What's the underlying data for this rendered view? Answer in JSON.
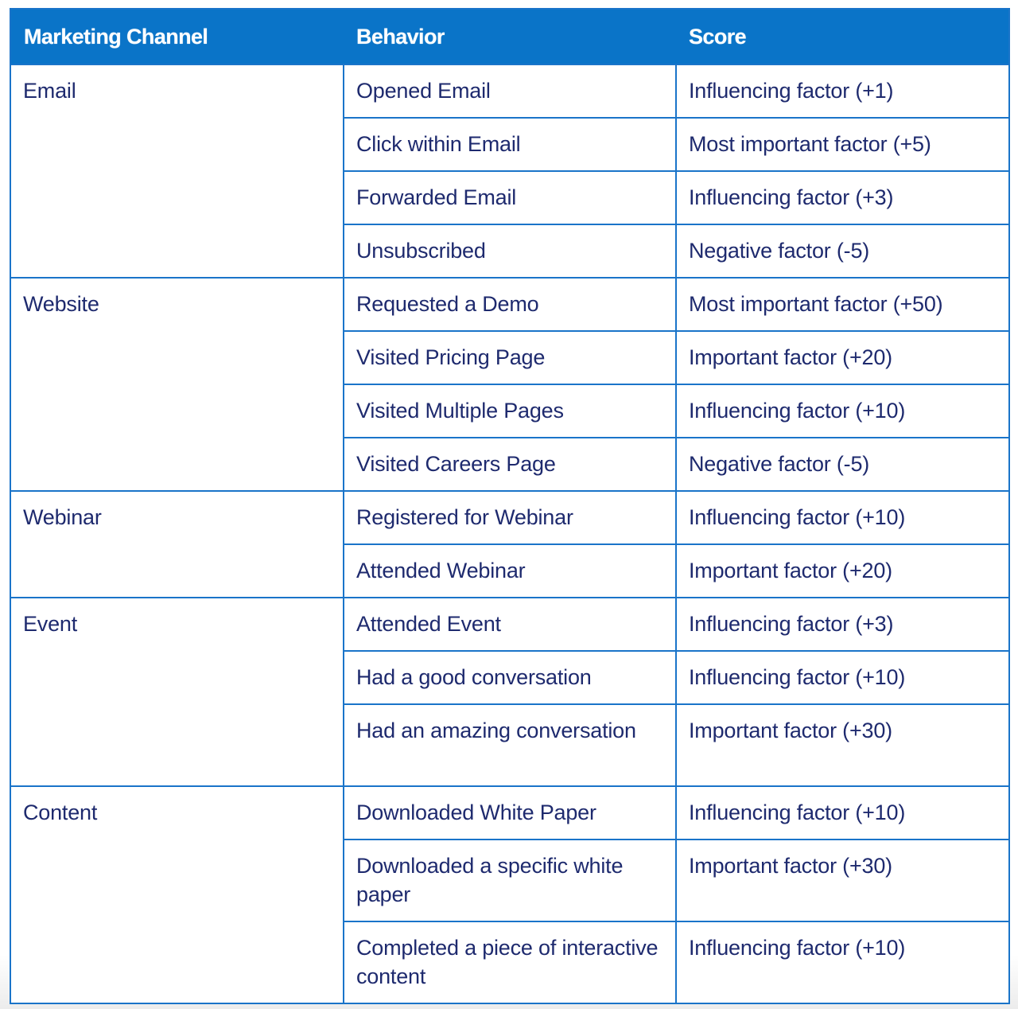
{
  "table": {
    "headers": [
      "Marketing Channel",
      "Behavior",
      "Score"
    ],
    "colors": {
      "header_bg": "#0a74c8",
      "header_text": "#ffffff",
      "border": "#1a74c9",
      "cell_text": "#1e2a6e"
    },
    "groups": [
      {
        "channel": "Email",
        "rows": [
          {
            "behavior": "Opened Email",
            "score": "Influencing factor (+1)"
          },
          {
            "behavior": "Click within Email",
            "score": "Most important factor (+5)"
          },
          {
            "behavior": "Forwarded Email",
            "score": "Influencing factor (+3)"
          },
          {
            "behavior": "Unsubscribed",
            "score": "Negative factor (-5)"
          }
        ]
      },
      {
        "channel": "Website",
        "rows": [
          {
            "behavior": "Requested a Demo",
            "score": "Most important factor (+50)"
          },
          {
            "behavior": "Visited Pricing Page",
            "score": "Important factor (+20)"
          },
          {
            "behavior": "Visited Multiple Pages",
            "score": "Influencing factor (+10)"
          },
          {
            "behavior": "Visited Careers Page",
            "score": "Negative factor (-5)"
          }
        ]
      },
      {
        "channel": "Webinar",
        "rows": [
          {
            "behavior": "Registered for Webinar",
            "score": "Influencing factor (+10)"
          },
          {
            "behavior": "Attended Webinar",
            "score": "Important factor (+20)"
          }
        ]
      },
      {
        "channel": "Event",
        "rows": [
          {
            "behavior": "Attended Event",
            "score": "Influencing factor (+3)"
          },
          {
            "behavior": "Had a good conversation",
            "score": "Influencing factor (+10)"
          },
          {
            "behavior": "Had an amazing conversation",
            "score": "Important factor (+30)"
          }
        ]
      },
      {
        "channel": "Content",
        "rows": [
          {
            "behavior": "Downloaded White Paper",
            "score": "Influencing factor (+10)"
          },
          {
            "behavior": "Downloaded a specific white paper",
            "score": "Important factor (+30)"
          },
          {
            "behavior": "Completed a piece of interactive content",
            "score": "Influencing factor (+10)"
          }
        ]
      }
    ]
  }
}
